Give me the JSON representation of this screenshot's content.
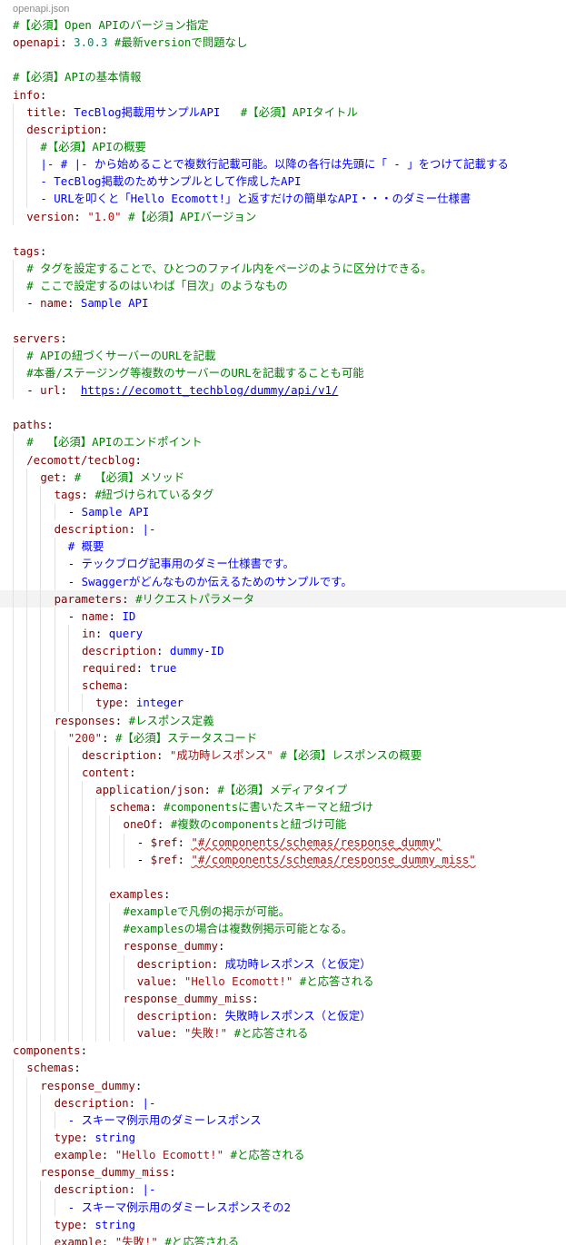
{
  "editor": {
    "filename": "openapi.json"
  },
  "lines": [
    {
      "i": 0,
      "t": [
        {
          "c": "cm",
          "v": "#【必須】Open APIのバージョン指定"
        }
      ]
    },
    {
      "i": 0,
      "t": [
        {
          "c": "key",
          "v": "openapi"
        },
        {
          "c": "punc",
          "v": ": "
        },
        {
          "c": "num",
          "v": "3.0.3"
        },
        {
          "c": "punc",
          "v": " "
        },
        {
          "c": "cm",
          "v": "#最新versionで問題なし"
        }
      ]
    },
    {
      "i": 0,
      "t": []
    },
    {
      "i": 0,
      "t": [
        {
          "c": "cm",
          "v": "#【必須】APIの基本情報"
        }
      ]
    },
    {
      "i": 0,
      "t": [
        {
          "c": "key",
          "v": "info"
        },
        {
          "c": "punc",
          "v": ":"
        }
      ]
    },
    {
      "i": 1,
      "t": [
        {
          "c": "key",
          "v": "title"
        },
        {
          "c": "punc",
          "v": ": "
        },
        {
          "c": "blk",
          "v": "TecBlog掲載用サンプルAPI"
        },
        {
          "c": "punc",
          "v": "   "
        },
        {
          "c": "cm",
          "v": "#【必須】APIタイトル"
        }
      ]
    },
    {
      "i": 1,
      "t": [
        {
          "c": "key",
          "v": "description"
        },
        {
          "c": "punc",
          "v": ":"
        }
      ]
    },
    {
      "i": 2,
      "t": [
        {
          "c": "cm",
          "v": "#【必須】APIの概要"
        }
      ]
    },
    {
      "i": 2,
      "t": [
        {
          "c": "blk",
          "v": "|- # |- から始めることで複数行記載可能。以降の各行は先頭に「 - 」をつけて記載する"
        }
      ]
    },
    {
      "i": 2,
      "t": [
        {
          "c": "blk",
          "v": "- TecBlog掲載のためサンプルとして作成したAPI"
        }
      ]
    },
    {
      "i": 2,
      "t": [
        {
          "c": "blk",
          "v": "- URLを叩くと「Hello Ecomott!」と返すだけの簡単なAPI・・・のダミー仕様書"
        }
      ]
    },
    {
      "i": 1,
      "t": [
        {
          "c": "key",
          "v": "version"
        },
        {
          "c": "punc",
          "v": ": "
        },
        {
          "c": "str",
          "v": "\"1.0\""
        },
        {
          "c": "punc",
          "v": " "
        },
        {
          "c": "cm",
          "v": "#【必須】APIバージョン"
        }
      ]
    },
    {
      "i": 0,
      "t": []
    },
    {
      "i": 0,
      "t": [
        {
          "c": "key",
          "v": "tags"
        },
        {
          "c": "punc",
          "v": ":"
        }
      ]
    },
    {
      "i": 1,
      "t": [
        {
          "c": "cm",
          "v": "# タグを設定することで、ひとつのファイル内をページのように区分けできる。"
        }
      ]
    },
    {
      "i": 1,
      "t": [
        {
          "c": "cm",
          "v": "# ここで設定するのはいわば「目次」のようなもの"
        }
      ]
    },
    {
      "i": 1,
      "t": [
        {
          "c": "punc",
          "v": "- "
        },
        {
          "c": "key",
          "v": "name"
        },
        {
          "c": "punc",
          "v": ": "
        },
        {
          "c": "blk",
          "v": "Sample API"
        }
      ]
    },
    {
      "i": 0,
      "t": []
    },
    {
      "i": 0,
      "t": [
        {
          "c": "key",
          "v": "servers"
        },
        {
          "c": "punc",
          "v": ":"
        }
      ]
    },
    {
      "i": 1,
      "t": [
        {
          "c": "cm",
          "v": "# APIの紐づくサーバーのURLを記載"
        }
      ]
    },
    {
      "i": 1,
      "t": [
        {
          "c": "cm",
          "v": "#本番/ステージング等複数のサーバーのURLを記載することも可能"
        }
      ]
    },
    {
      "i": 1,
      "t": [
        {
          "c": "punc",
          "v": "- "
        },
        {
          "c": "key",
          "v": "url"
        },
        {
          "c": "punc",
          "v": ":  "
        },
        {
          "c": "url",
          "v": "https://ecomott_techblog/dummy/api/v1/"
        }
      ]
    },
    {
      "i": 0,
      "t": []
    },
    {
      "i": 0,
      "t": [
        {
          "c": "key",
          "v": "paths"
        },
        {
          "c": "punc",
          "v": ":"
        }
      ]
    },
    {
      "i": 1,
      "t": [
        {
          "c": "cm",
          "v": "#  【必須】APIのエンドポイント"
        }
      ]
    },
    {
      "i": 1,
      "t": [
        {
          "c": "key",
          "v": "/ecomott/tecblog"
        },
        {
          "c": "punc",
          "v": ":"
        }
      ]
    },
    {
      "i": 2,
      "t": [
        {
          "c": "key",
          "v": "get"
        },
        {
          "c": "punc",
          "v": ": "
        },
        {
          "c": "cm",
          "v": "#  【必須】メソッド"
        }
      ]
    },
    {
      "i": 3,
      "t": [
        {
          "c": "key",
          "v": "tags"
        },
        {
          "c": "punc",
          "v": ": "
        },
        {
          "c": "cm",
          "v": "#紐づけられているタグ"
        }
      ]
    },
    {
      "i": 4,
      "t": [
        {
          "c": "punc",
          "v": "- "
        },
        {
          "c": "blk",
          "v": "Sample API"
        }
      ]
    },
    {
      "i": 3,
      "t": [
        {
          "c": "key",
          "v": "description"
        },
        {
          "c": "punc",
          "v": ": "
        },
        {
          "c": "kw",
          "v": "|-"
        }
      ]
    },
    {
      "i": 4,
      "t": [
        {
          "c": "blk",
          "v": "# 概要"
        }
      ]
    },
    {
      "i": 4,
      "t": [
        {
          "c": "blk",
          "v": "- テックブログ記事用のダミー仕様書です。"
        }
      ]
    },
    {
      "i": 4,
      "t": [
        {
          "c": "blk",
          "v": "- Swaggerがどんなものか伝えるためのサンプルです。"
        }
      ]
    },
    {
      "i": 3,
      "hl": true,
      "t": [
        {
          "c": "key",
          "v": "parameters"
        },
        {
          "c": "punc",
          "v": ": "
        },
        {
          "c": "cm",
          "v": "#リクエストパラメータ"
        }
      ]
    },
    {
      "i": 4,
      "t": [
        {
          "c": "punc",
          "v": "- "
        },
        {
          "c": "key",
          "v": "name"
        },
        {
          "c": "punc",
          "v": ": "
        },
        {
          "c": "blk",
          "v": "ID"
        }
      ]
    },
    {
      "i": 5,
      "t": [
        {
          "c": "key",
          "v": "in"
        },
        {
          "c": "punc",
          "v": ": "
        },
        {
          "c": "blk",
          "v": "query"
        }
      ]
    },
    {
      "i": 5,
      "t": [
        {
          "c": "key",
          "v": "description"
        },
        {
          "c": "punc",
          "v": ": "
        },
        {
          "c": "blk",
          "v": "dummy-ID"
        }
      ]
    },
    {
      "i": 5,
      "t": [
        {
          "c": "key",
          "v": "required"
        },
        {
          "c": "punc",
          "v": ": "
        },
        {
          "c": "kw",
          "v": "true"
        }
      ]
    },
    {
      "i": 5,
      "t": [
        {
          "c": "key",
          "v": "schema"
        },
        {
          "c": "punc",
          "v": ":"
        }
      ]
    },
    {
      "i": 6,
      "t": [
        {
          "c": "key",
          "v": "type"
        },
        {
          "c": "punc",
          "v": ": "
        },
        {
          "c": "blk",
          "v": "integer"
        }
      ]
    },
    {
      "i": 3,
      "t": [
        {
          "c": "key",
          "v": "responses"
        },
        {
          "c": "punc",
          "v": ": "
        },
        {
          "c": "cm",
          "v": "#レスポンス定義"
        }
      ]
    },
    {
      "i": 4,
      "t": [
        {
          "c": "str",
          "v": "\"200\""
        },
        {
          "c": "punc",
          "v": ": "
        },
        {
          "c": "cm",
          "v": "#【必須】ステータスコード"
        }
      ]
    },
    {
      "i": 5,
      "t": [
        {
          "c": "key",
          "v": "description"
        },
        {
          "c": "punc",
          "v": ": "
        },
        {
          "c": "str",
          "v": "\"成功時レスポンス\""
        },
        {
          "c": "punc",
          "v": " "
        },
        {
          "c": "cm",
          "v": "#【必須】レスポンスの概要"
        }
      ]
    },
    {
      "i": 5,
      "t": [
        {
          "c": "key",
          "v": "content"
        },
        {
          "c": "punc",
          "v": ":"
        }
      ]
    },
    {
      "i": 6,
      "t": [
        {
          "c": "key",
          "v": "application/json"
        },
        {
          "c": "punc",
          "v": ": "
        },
        {
          "c": "cm",
          "v": "#【必須】メディアタイプ"
        }
      ]
    },
    {
      "i": 7,
      "t": [
        {
          "c": "key",
          "v": "schema"
        },
        {
          "c": "punc",
          "v": ": "
        },
        {
          "c": "cm",
          "v": "#componentsに書いたスキーマと紐づけ"
        }
      ]
    },
    {
      "i": 8,
      "t": [
        {
          "c": "key",
          "v": "oneOf"
        },
        {
          "c": "punc",
          "v": ": "
        },
        {
          "c": "cm",
          "v": "#複数のcomponentsと紐づけ可能"
        }
      ]
    },
    {
      "i": 9,
      "t": [
        {
          "c": "punc",
          "v": "- "
        },
        {
          "c": "key",
          "v": "$ref"
        },
        {
          "c": "punc",
          "v": ": "
        },
        {
          "c": "str sq",
          "v": "\"#/components/schemas/response_dummy\""
        }
      ]
    },
    {
      "i": 9,
      "t": [
        {
          "c": "punc",
          "v": "- "
        },
        {
          "c": "key",
          "v": "$ref"
        },
        {
          "c": "punc",
          "v": ": "
        },
        {
          "c": "str sq",
          "v": "\"#/components/schemas/response_dummy_miss\""
        }
      ]
    },
    {
      "i": 7,
      "t": []
    },
    {
      "i": 7,
      "t": [
        {
          "c": "key",
          "v": "examples"
        },
        {
          "c": "punc",
          "v": ":"
        }
      ]
    },
    {
      "i": 8,
      "t": [
        {
          "c": "cm",
          "v": "#exampleで凡例の掲示が可能。"
        }
      ]
    },
    {
      "i": 8,
      "t": [
        {
          "c": "cm",
          "v": "#examplesの場合は複数例掲示可能となる。"
        }
      ]
    },
    {
      "i": 8,
      "t": [
        {
          "c": "key",
          "v": "response_dummy"
        },
        {
          "c": "punc",
          "v": ":"
        }
      ]
    },
    {
      "i": 9,
      "t": [
        {
          "c": "key",
          "v": "description"
        },
        {
          "c": "punc",
          "v": ": "
        },
        {
          "c": "blk",
          "v": "成功時レスポンス（と仮定）"
        }
      ]
    },
    {
      "i": 9,
      "t": [
        {
          "c": "key",
          "v": "value"
        },
        {
          "c": "punc",
          "v": ": "
        },
        {
          "c": "str",
          "v": "\"Hello Ecomott!\""
        },
        {
          "c": "punc",
          "v": " "
        },
        {
          "c": "cm",
          "v": "#と応答される"
        }
      ]
    },
    {
      "i": 8,
      "t": [
        {
          "c": "key",
          "v": "response_dummy_miss"
        },
        {
          "c": "punc",
          "v": ":"
        }
      ]
    },
    {
      "i": 9,
      "t": [
        {
          "c": "key",
          "v": "description"
        },
        {
          "c": "punc",
          "v": ": "
        },
        {
          "c": "blk",
          "v": "失敗時レスポンス（と仮定）"
        }
      ]
    },
    {
      "i": 9,
      "t": [
        {
          "c": "key",
          "v": "value"
        },
        {
          "c": "punc",
          "v": ": "
        },
        {
          "c": "str",
          "v": "\"失敗!\""
        },
        {
          "c": "punc",
          "v": " "
        },
        {
          "c": "cm",
          "v": "#と応答される"
        }
      ]
    },
    {
      "i": 0,
      "t": [
        {
          "c": "key",
          "v": "components"
        },
        {
          "c": "punc",
          "v": ":"
        }
      ]
    },
    {
      "i": 1,
      "t": [
        {
          "c": "key",
          "v": "schemas"
        },
        {
          "c": "punc",
          "v": ":"
        }
      ]
    },
    {
      "i": 2,
      "t": [
        {
          "c": "key",
          "v": "response_dummy"
        },
        {
          "c": "punc",
          "v": ":"
        }
      ]
    },
    {
      "i": 3,
      "t": [
        {
          "c": "key",
          "v": "description"
        },
        {
          "c": "punc",
          "v": ": "
        },
        {
          "c": "kw",
          "v": "|-"
        }
      ]
    },
    {
      "i": 4,
      "t": [
        {
          "c": "blk",
          "v": "- スキーマ例示用のダミーレスポンス"
        }
      ]
    },
    {
      "i": 3,
      "t": [
        {
          "c": "key",
          "v": "type"
        },
        {
          "c": "punc",
          "v": ": "
        },
        {
          "c": "blk",
          "v": "string"
        }
      ]
    },
    {
      "i": 3,
      "t": [
        {
          "c": "key",
          "v": "example"
        },
        {
          "c": "punc",
          "v": ": "
        },
        {
          "c": "str",
          "v": "\"Hello Ecomott!\""
        },
        {
          "c": "punc",
          "v": " "
        },
        {
          "c": "cm",
          "v": "#と応答される"
        }
      ]
    },
    {
      "i": 2,
      "t": [
        {
          "c": "key",
          "v": "response_dummy_miss"
        },
        {
          "c": "punc",
          "v": ":"
        }
      ]
    },
    {
      "i": 3,
      "t": [
        {
          "c": "key",
          "v": "description"
        },
        {
          "c": "punc",
          "v": ": "
        },
        {
          "c": "kw",
          "v": "|-"
        }
      ]
    },
    {
      "i": 4,
      "t": [
        {
          "c": "blk",
          "v": "- スキーマ例示用のダミーレスポンスその2"
        }
      ]
    },
    {
      "i": 3,
      "t": [
        {
          "c": "key",
          "v": "type"
        },
        {
          "c": "punc",
          "v": ": "
        },
        {
          "c": "blk",
          "v": "string"
        }
      ]
    },
    {
      "i": 3,
      "t": [
        {
          "c": "key",
          "v": "example"
        },
        {
          "c": "punc",
          "v": ": "
        },
        {
          "c": "str",
          "v": "\"失敗!\""
        },
        {
          "c": "punc",
          "v": " "
        },
        {
          "c": "cm",
          "v": "#と応答される"
        }
      ]
    }
  ],
  "colors": {
    "key": "#800000",
    "comment": "#008000",
    "number": "#098658",
    "string": "#a31515",
    "keyword": "#0000ff",
    "link": "#0000ee"
  }
}
